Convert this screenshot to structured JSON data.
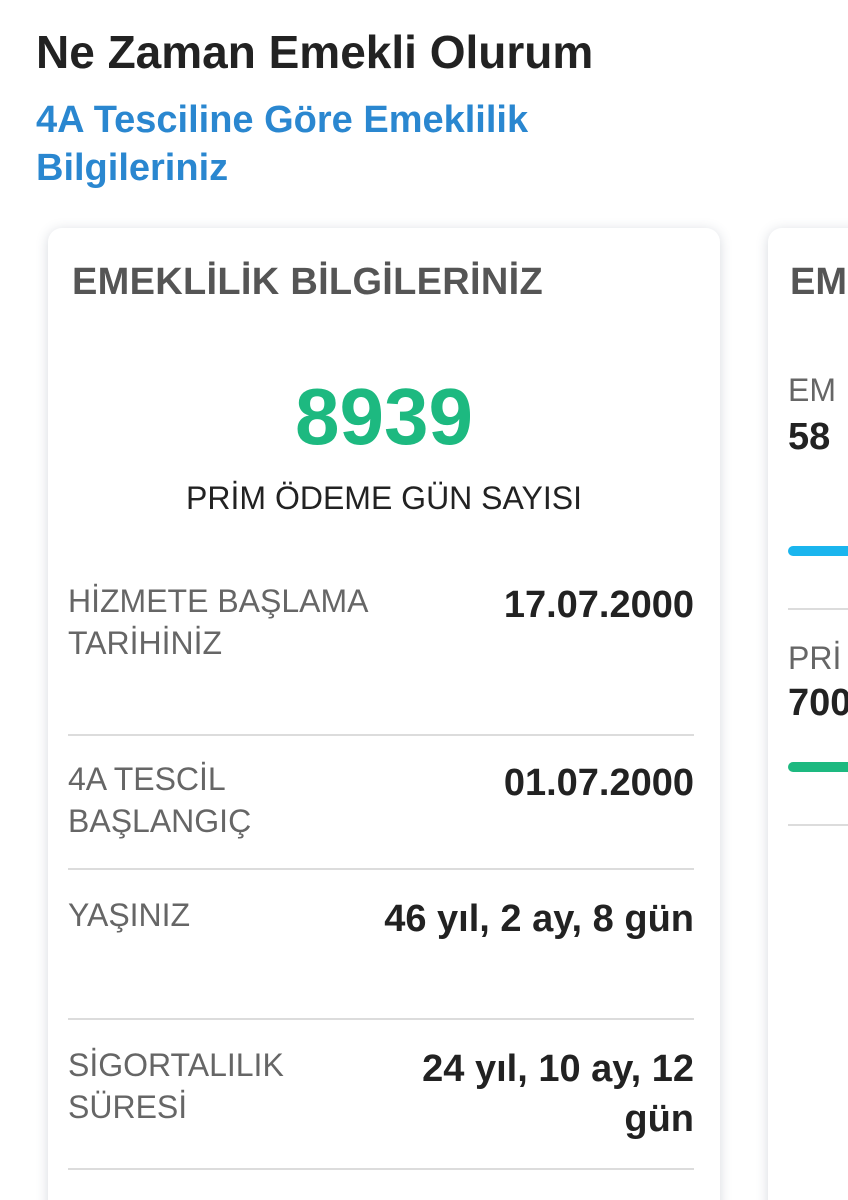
{
  "header": {
    "title": "Ne Zaman Emekli Olurum",
    "subtitle": "4A Tesciline Göre Emeklilik Bilgileriniz"
  },
  "main_card": {
    "title": "EMEKLİLİK BİLGİLERİNİZ",
    "prim_days": "8939",
    "prim_caption": "PRİM ÖDEME GÜN SAYISI",
    "rows": [
      {
        "label": "HİZMETE BAŞLAMA TARİHİNİZ",
        "value": "17.07.2000"
      },
      {
        "label": "4A TESCİL BAŞLANGIÇ",
        "value": "01.07.2000"
      },
      {
        "label": "YAŞINIZ",
        "value": "46 yıl, 2 ay, 8 gün"
      },
      {
        "label": "SİGORTALILIK SÜRESİ",
        "value": "24 yıl, 10 ay, 12 gün"
      }
    ]
  },
  "side_card": {
    "title": "EM",
    "items": [
      {
        "label": "EM",
        "value": "58",
        "bar_color": "#1ab5ee"
      },
      {
        "label": "PRİ",
        "value": "700",
        "bar_color": "#1db980"
      }
    ]
  },
  "colors": {
    "accent_blue": "#2a87d0",
    "accent_green": "#1db980",
    "bar_blue": "#1ab5ee"
  }
}
